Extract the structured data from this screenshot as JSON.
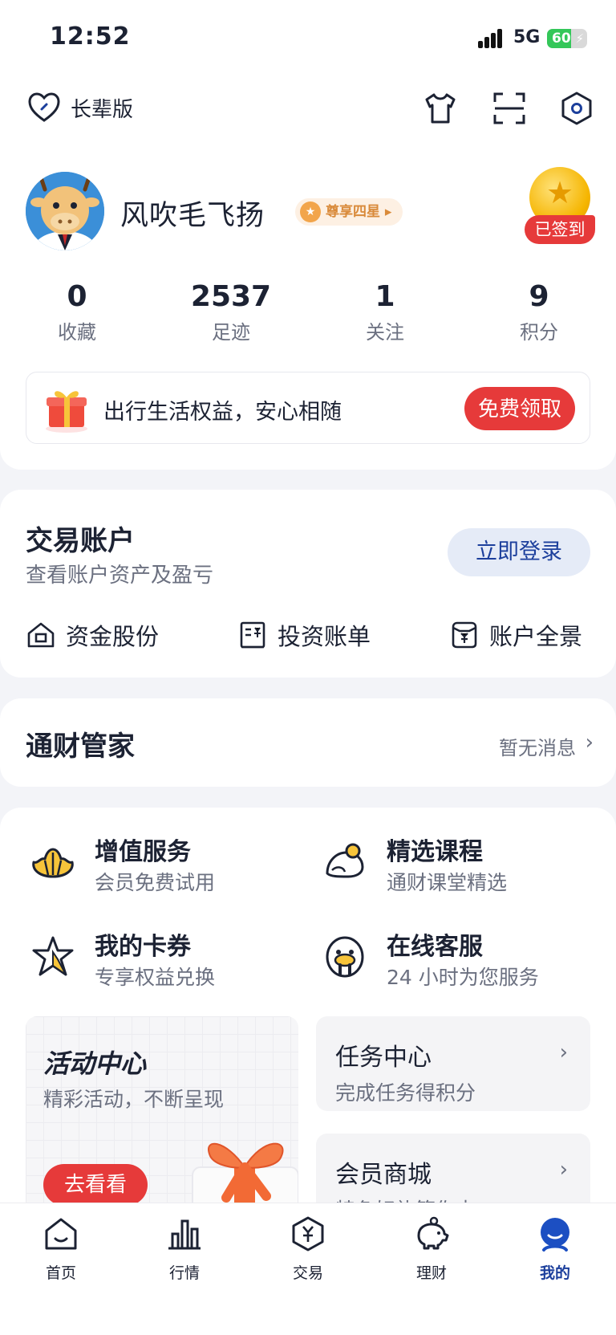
{
  "status_bar": {
    "time": "12:52",
    "network": "5G",
    "battery": "60",
    "battery_level": 0.6
  },
  "header": {
    "elder_mode_label": "长辈版",
    "icons": [
      "tshirt-icon",
      "scan-icon",
      "settings-hexagon-icon"
    ]
  },
  "profile": {
    "username": "风吹毛飞扬",
    "vip_badge": "尊享四星",
    "signed_in_label": "已签到"
  },
  "stats": [
    {
      "value": "0",
      "label": "收藏"
    },
    {
      "value": "2537",
      "label": "足迹"
    },
    {
      "value": "1",
      "label": "关注"
    },
    {
      "value": "9",
      "label": "积分"
    }
  ],
  "promo": {
    "text": "出行生活权益，安心相随",
    "button": "免费领取"
  },
  "account": {
    "title": "交易账户",
    "subtitle": "查看账户资产及盈亏",
    "login_button": "立即登录",
    "links": [
      {
        "label": "资金股份",
        "icon": "house-icon"
      },
      {
        "label": "投资账单",
        "icon": "bill-icon"
      },
      {
        "label": "账户全景",
        "icon": "wallet-yuan-icon"
      }
    ]
  },
  "steward": {
    "title": "通财管家",
    "message": "暂无消息"
  },
  "services": [
    {
      "title": "增值服务",
      "subtitle": "会员免费试用",
      "icon": "shell-icon"
    },
    {
      "title": "精选课程",
      "subtitle": "通财课堂精选",
      "icon": "bird-icon"
    },
    {
      "title": "我的卡券",
      "subtitle": "专享权益兑换",
      "icon": "star-icon"
    },
    {
      "title": "在线客服",
      "subtitle": "24 小时为您服务",
      "icon": "walrus-icon"
    }
  ],
  "activity": {
    "title": "活动中心",
    "subtitle": "精彩活动，不断呈现",
    "button": "去看看"
  },
  "task_center": {
    "title": "任务中心",
    "subtitle": "完成任务得积分"
  },
  "member_mall": {
    "title": "会员商城",
    "subtitle": "特色好礼等你来"
  },
  "tabs": [
    {
      "label": "首页",
      "icon": "home-icon"
    },
    {
      "label": "行情",
      "icon": "bar-chart-icon"
    },
    {
      "label": "交易",
      "icon": "yuan-hexagon-icon"
    },
    {
      "label": "理财",
      "icon": "piggy-bank-icon"
    },
    {
      "label": "我的",
      "icon": "user-icon",
      "active": true
    }
  ],
  "colors": {
    "accent_red": "#e63a3a",
    "brand_blue": "#1c3f9c",
    "login_bg": "#e5ebf7"
  }
}
